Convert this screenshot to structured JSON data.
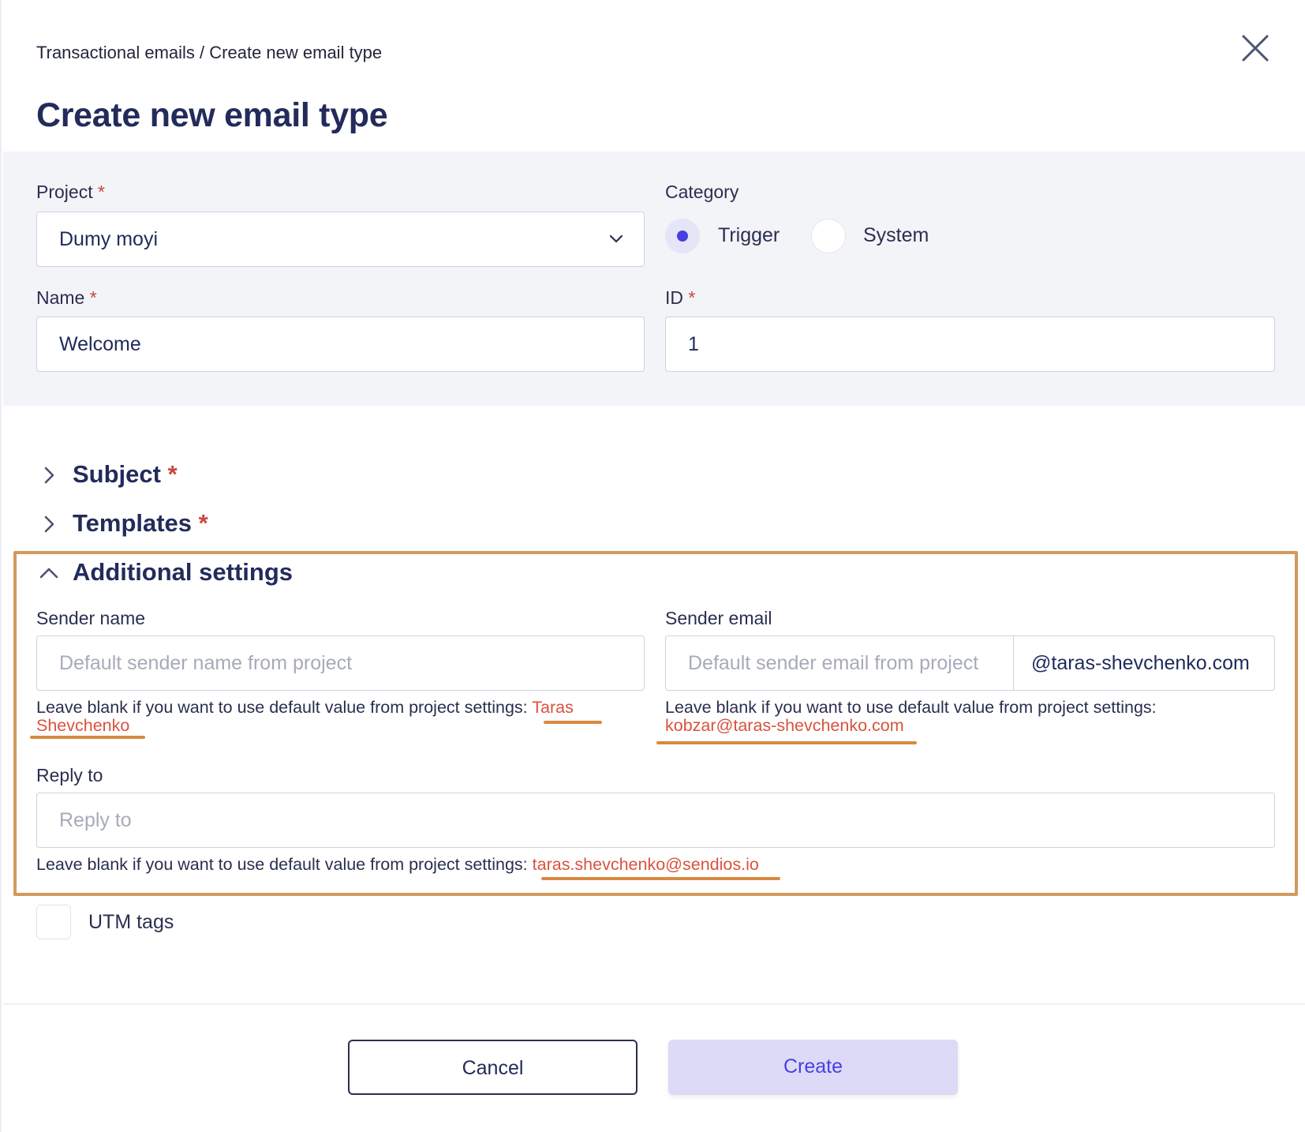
{
  "breadcrumb": "Transactional emails / Create new email type",
  "title": "Create new email type",
  "required_mark": "*",
  "project": {
    "label": "Project",
    "value": "Dumy moyi"
  },
  "category": {
    "label": "Category",
    "options": [
      "Trigger",
      "System"
    ],
    "selected": "Trigger"
  },
  "name": {
    "label": "Name",
    "value": "Welcome"
  },
  "id_field": {
    "label": "ID",
    "value": "1"
  },
  "sections": {
    "subject": "Subject",
    "templates": "Templates",
    "additional": "Additional settings"
  },
  "sender_name": {
    "label": "Sender name",
    "placeholder": "Default sender name from project",
    "hint_prefix": "Leave blank if you want to use default value from project settings:",
    "hint_value_line1": "Taras",
    "hint_value_line2": "Shevchenko"
  },
  "sender_email": {
    "label": "Sender email",
    "placeholder": "Default sender email from project",
    "domain_suffix": "@taras-shevchenko.com",
    "hint_prefix": "Leave blank if you want to use default value from project settings:",
    "hint_value": "kobzar@taras-shevchenko.com"
  },
  "reply_to": {
    "label": "Reply to",
    "placeholder": "Reply to",
    "hint_prefix": "Leave blank if you want to use default value from project settings:",
    "hint_value": "taras.shevchenko@sendios.io"
  },
  "utm": {
    "label": "UTM tags",
    "checked": false
  },
  "buttons": {
    "cancel": "Cancel",
    "create": "Create"
  },
  "colors": {
    "accent": "#4a3fe0",
    "required": "#c8463f",
    "highlight": "#d29a5c",
    "hint_value": "#d9533e"
  }
}
